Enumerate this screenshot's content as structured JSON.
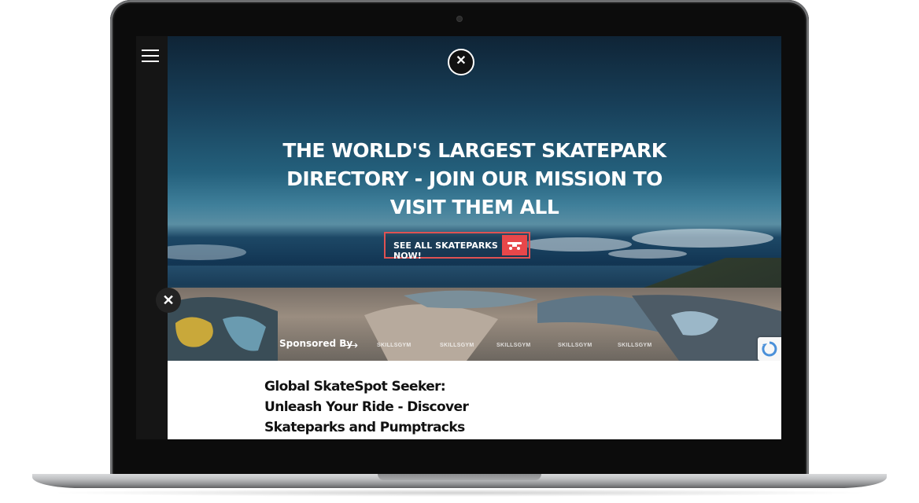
{
  "site": {
    "menu_icon": "hamburger-icon",
    "close_icon": "close-icon",
    "logo_icon": "skatepark-logo-icon"
  },
  "hero": {
    "headline": "THE WORLD'S LARGEST SKATEPARK DIRECTORY - JOIN OUR MISSION TO VISIT THEM ALL",
    "cta_label": "SEE ALL SKATEPARKS NOW!",
    "cta_icon": "skateboard-truck-icon",
    "accent_color": "#e8474a"
  },
  "sponsor": {
    "label": "Sponsored By",
    "arrow": "⟶",
    "logos": [
      "SKILLSGYM",
      "SKILLSGYM",
      "SKILLSGYM",
      "SKILLSGYM",
      "SKILLSGYM"
    ]
  },
  "content": {
    "title": "Global SkateSpot Seeker: Unleash Your Ride - Discover Skateparks and Pumptracks Worldwide!"
  }
}
